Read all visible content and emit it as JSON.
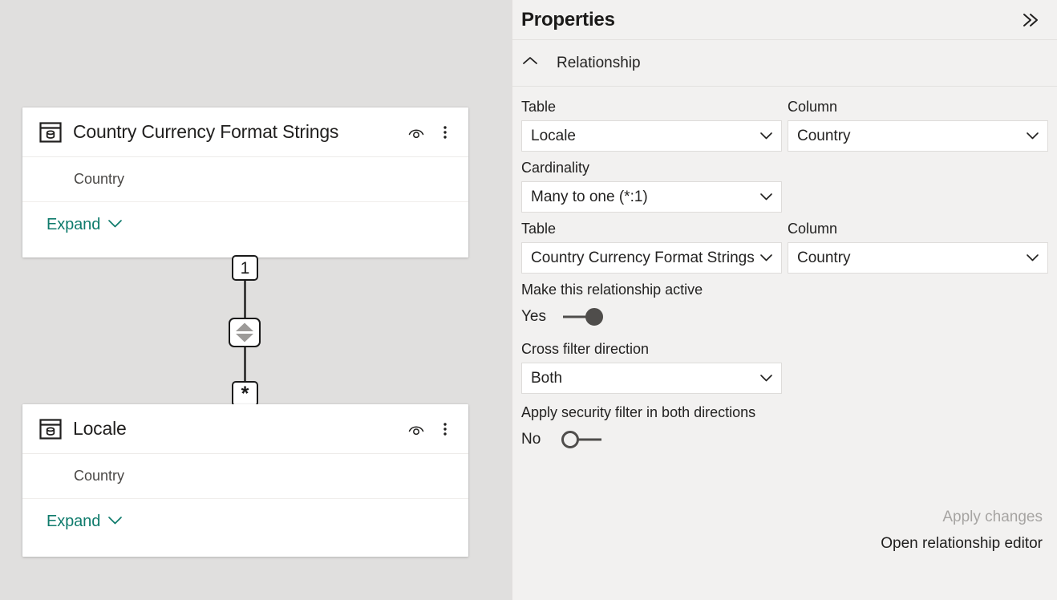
{
  "canvas": {
    "tables": [
      {
        "name": "Country Currency Format Strings",
        "icon": "table-icon",
        "hide_icon": "eye-icon",
        "more_icon": "more-vertical-icon",
        "columns": [
          "Country"
        ],
        "expand_label": "Expand",
        "expand_icon": "chevron-down-icon"
      },
      {
        "name": "Locale",
        "icon": "table-icon",
        "hide_icon": "eye-icon",
        "more_icon": "more-vertical-icon",
        "columns": [
          "Country"
        ],
        "expand_label": "Expand",
        "expand_icon": "chevron-down-icon"
      }
    ],
    "relationship_line": {
      "top_badge": "1",
      "bottom_badge": "*",
      "direction_icon": "bidirectional-arrow-icon"
    },
    "background_color": "#e0dfde"
  },
  "panel": {
    "title": "Properties",
    "collapse_icon": "double-chevron-right-icon",
    "section": {
      "title": "Relationship",
      "collapse_icon": "chevron-up-icon"
    },
    "fields": {
      "table_from_label": "Table",
      "table_from_value": "Locale",
      "column_from_label": "Column",
      "column_from_value": "Country",
      "cardinality_label": "Cardinality",
      "cardinality_value": "Many to one (*:1)",
      "table_to_label": "Table",
      "table_to_value": "Country Currency Format Strings",
      "column_to_label": "Column",
      "column_to_value": "Country",
      "active_label": "Make this relationship active",
      "active_state": "Yes",
      "cross_filter_label": "Cross filter direction",
      "cross_filter_value": "Both",
      "security_filter_label": "Apply security filter in both directions",
      "security_filter_state": "No",
      "dropdown_icon": "chevron-down-icon"
    },
    "actions": {
      "apply_label": "Apply changes",
      "open_editor_label": "Open relationship editor"
    },
    "background_color": "#f2f1f0",
    "accent_color": "#0f7b6c"
  }
}
